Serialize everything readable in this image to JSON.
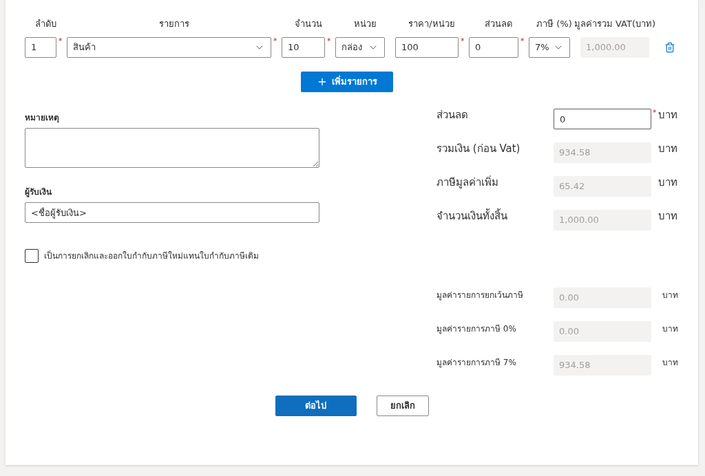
{
  "required_mark": "*",
  "line_items": {
    "columns": [
      "ลำดับ",
      "รายการ",
      "จำนวน",
      "หน่วย",
      "ราคา/หน่วย",
      "ส่วนลด",
      "ภาษี (%)",
      "มูลค่ารวม VAT(บาท)"
    ],
    "rows": [
      {
        "cells": [
          {
            "kind": "input",
            "value": "1",
            "required": true
          },
          {
            "kind": "dropdown",
            "value": "สินค้า",
            "required": true
          },
          {
            "kind": "input",
            "value": "10",
            "required": true
          },
          {
            "kind": "dropdown",
            "value": "กล่อง",
            "required": false
          },
          {
            "kind": "input",
            "value": "100",
            "required": true
          },
          {
            "kind": "input",
            "value": "0",
            "required": true
          },
          {
            "kind": "dropdown",
            "value": "7%",
            "required": false
          },
          {
            "kind": "readonly",
            "value": "1,000.00",
            "required": false
          }
        ]
      }
    ]
  },
  "add_button": "เพิ่มรายการ",
  "remarks": {
    "label": "หมายเหตุ"
  },
  "payee": {
    "label": "ผู้รับเงิน",
    "value": "<ชื่อผู้รับเงิน>"
  },
  "reissue_checkbox": {
    "label": "เป็นการยกเลิกและออกใบกำกับภาษีใหม่แทนใบกำกับภาษีเดิม",
    "checked": false
  },
  "summary": [
    {
      "label": "ส่วนลด",
      "value": "0",
      "unit": "บาท",
      "editable": true,
      "required": true
    },
    {
      "label": "รวมเงิน (ก่อน Vat)",
      "value": "934.58",
      "unit": "บาท",
      "editable": false,
      "required": false
    },
    {
      "label": "ภาษีมูลค่าเพิ่ม",
      "value": "65.42",
      "unit": "บาท",
      "editable": false,
      "required": false
    },
    {
      "label": "จำนวนเงินทั้งสิ้น",
      "value": "1,000.00",
      "unit": "บาท",
      "editable": false,
      "required": false
    }
  ],
  "breakdown": [
    {
      "label": "มูลค่ารายการยกเว้นภาษี",
      "value": "0.00",
      "unit": "บาท"
    },
    {
      "label": "มูลค่ารายการภาษี 0%",
      "value": "0.00",
      "unit": "บาท"
    },
    {
      "label": "มูลค่ารายการภาษี 7%",
      "value": "934.58",
      "unit": "บาท"
    }
  ],
  "buttons": [
    {
      "label": "ต่อไป",
      "kind": "primary"
    },
    {
      "label": "ยกเลิก",
      "kind": "secondary"
    }
  ]
}
